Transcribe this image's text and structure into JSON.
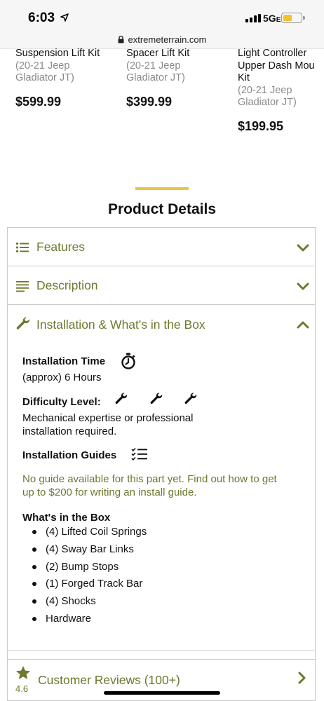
{
  "status_bar": {
    "time": "6:03",
    "network": "5G",
    "network_suffix": "E"
  },
  "browser": {
    "url": "extremeterrain.com"
  },
  "products": [
    {
      "title": "Suspension Lift Kit",
      "fitment_line1": "(20-21 Jeep",
      "fitment_line2": "Gladiator JT)",
      "price": "$599.99"
    },
    {
      "title": "Spacer Lift Kit",
      "fitment_line1": "(20-21 Jeep",
      "fitment_line2": "Gladiator JT)",
      "price": "$399.99"
    },
    {
      "title": "Light Controller",
      "title2": "Upper Dash Mou",
      "title3": "Kit",
      "fitment_line1": "(20-21 Jeep",
      "fitment_line2": "Gladiator JT)",
      "price": "$199.95"
    }
  ],
  "section": {
    "title": "Product Details"
  },
  "accordion": {
    "features_label": "Features",
    "description_label": "Description",
    "installation_label": "Installation & What's in the Box",
    "installation": {
      "time_label": "Installation Time",
      "time_value": "(approx) 6 Hours",
      "difficulty_label": "Difficulty Level:",
      "difficulty_level": 3,
      "difficulty_text1": "Mechanical expertise or professional",
      "difficulty_text2": "installation required.",
      "guides_label": "Installation Guides",
      "guides_text1": "No guide available for this part yet. Find out how to get",
      "guides_text2": "up to $200 for writing an install guide.",
      "box_label": "What's in the Box",
      "box_items": [
        "(4) Lifted Coil Springs",
        "(4) Sway Bar Links",
        "(2) Bump Stops",
        "(1) Forged Track Bar",
        "(4) Shocks",
        "Hardware"
      ]
    },
    "reviews_label": "Customer Reviews (100+)",
    "rating": "4.6"
  },
  "colors": {
    "accent_green": "#6a7a2e",
    "gold": "#e9c54a"
  },
  "icons": {
    "features": "list-icon",
    "description": "lines-icon",
    "installation": "wrench-icon",
    "time": "stopwatch-icon",
    "difficulty": "wrench-icon",
    "guides": "checklist-icon",
    "reviews": "star-icon"
  }
}
